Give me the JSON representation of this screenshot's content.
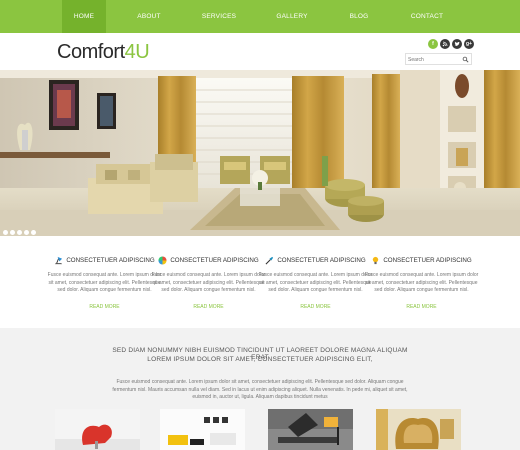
{
  "nav": {
    "items": [
      {
        "label": "HOME"
      },
      {
        "label": "ABOUT"
      },
      {
        "label": "SERVICES"
      },
      {
        "label": "GALLERY"
      },
      {
        "label": "BLOG"
      },
      {
        "label": "CONTACT"
      }
    ]
  },
  "header": {
    "logo_main": "Comfort",
    "logo_accent": "4U",
    "social": [
      {
        "glyph": "f",
        "icon": "facebook-icon",
        "color": "#8bc540"
      },
      {
        "glyph": "rss",
        "icon": "rss-icon",
        "color": "#3a3a3a"
      },
      {
        "glyph": "t",
        "icon": "twitter-icon",
        "color": "#3a3a3a"
      },
      {
        "glyph": "g+",
        "icon": "google-plus-icon",
        "color": "#3a3a3a"
      }
    ],
    "search_placeholder": "Search"
  },
  "features": [
    {
      "title": "CONSECTETUER ADIPISCING",
      "icon": "lamp-icon",
      "body": "Fusce euismod consequat ante. Lorem ipsum dolor sit amet, consectetuer adipiscing elit. Pellentesque sed dolor. Aliquam congue fermentum nisl.",
      "more": "READ MORE"
    },
    {
      "title": "CONSECTETUER ADIPISCING",
      "icon": "color-wheel-icon",
      "body": "Fusce euismod consequat ante. Lorem ipsum dolor sit amet, consectetuer adipiscing elit. Pellentesque sed dolor. Aliquam congue fermentum nisl.",
      "more": "READ MORE"
    },
    {
      "title": "CONSECTETUER ADIPISCING",
      "icon": "brush-icon",
      "body": "Fusce euismod consequat ante. Lorem ipsum dolor sit amet, consectetuer adipiscing elit. Pellentesque sed dolor. Aliquam congue fermentum nisl.",
      "more": "READ MORE"
    },
    {
      "title": "CONSECTETUER ADIPISCING",
      "icon": "bulb-icon",
      "body": "Fusce euismod consequat ante. Lorem ipsum dolor sit amet, consectetuer adipiscing elit. Pellentesque sed dolor. Aliquam congue fermentum nisl.",
      "more": "READ MORE"
    }
  ],
  "band": {
    "heading_line1": "SED DIAM NONUMMY NIBH EUISMOD TINCIDUNT UT LAOREET DOLORE MAGNA ALIQUAM ERAT",
    "heading_line2": "LOREM IPSUM DOLOR SIT AMET, CONSECTETUER ADIPISCING ELIT,",
    "paragraph": "Fusce euismod consequat ante. Lorem ipsum dolor sit amet, consectetuer adipiscing elit. Pellentesque sed dolor. Aliquam congue fermentum nisl. Mauris accumsan nulla vel diam. Sed in lacus ut enim adipiscing aliquet. Nulla venenatis. In pede mi, aliquet sit amet, euismod in, auctor ut, ligula. Aliquam dapibus tincidunt metus"
  },
  "colors": {
    "accent": "#8bc540",
    "nav_active": "#75b22c",
    "band_bg": "#f2f2f2"
  },
  "slider": {
    "slides": 5,
    "active": 1
  }
}
